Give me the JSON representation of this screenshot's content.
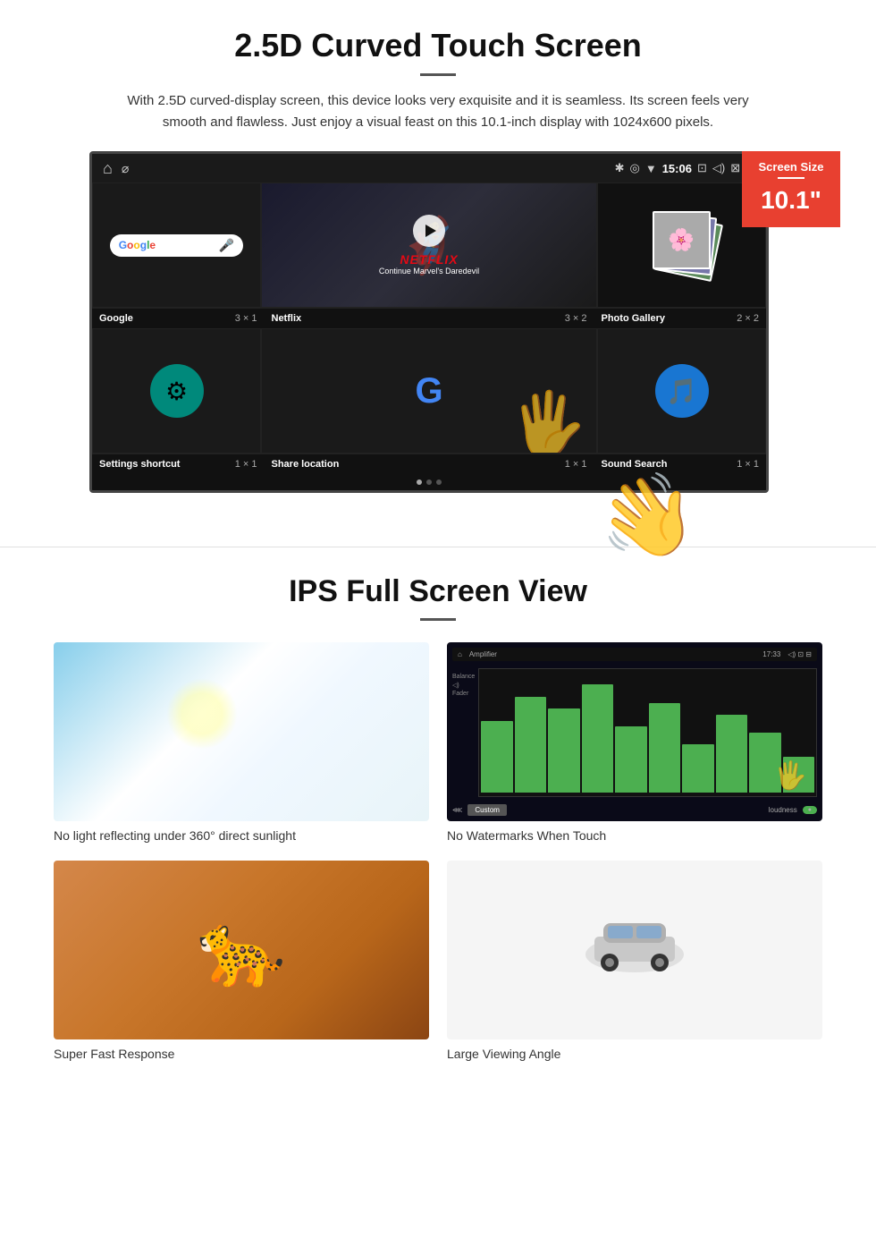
{
  "section1": {
    "title": "2.5D Curved Touch Screen",
    "description": "With 2.5D curved-display screen, this device looks very exquisite and it is seamless. Its screen feels very smooth and flawless. Just enjoy a visual feast on this 10.1-inch display with 1024x600 pixels.",
    "screen_badge": {
      "label": "Screen Size",
      "size": "10.1\""
    },
    "status_bar": {
      "time": "15:06"
    },
    "app_row1": [
      {
        "name": "Google",
        "size": "3 × 1"
      },
      {
        "name": "Netflix",
        "size": "3 × 2"
      },
      {
        "name": "Photo Gallery",
        "size": "2 × 2"
      }
    ],
    "app_row2": [
      {
        "name": "Settings shortcut",
        "size": "1 × 1"
      },
      {
        "name": "Share location",
        "size": "1 × 1"
      },
      {
        "name": "Sound Search",
        "size": "1 × 1"
      }
    ],
    "netflix_logo": "NETFLIX",
    "netflix_sub": "Continue Marvel's Daredevil"
  },
  "section2": {
    "title": "IPS Full Screen View",
    "features": [
      {
        "id": "sunlight",
        "caption": "No light reflecting under 360° direct sunlight"
      },
      {
        "id": "amplifier",
        "caption": "No Watermarks When Touch"
      },
      {
        "id": "cheetah",
        "caption": "Super Fast Response"
      },
      {
        "id": "car",
        "caption": "Large Viewing Angle"
      }
    ]
  }
}
